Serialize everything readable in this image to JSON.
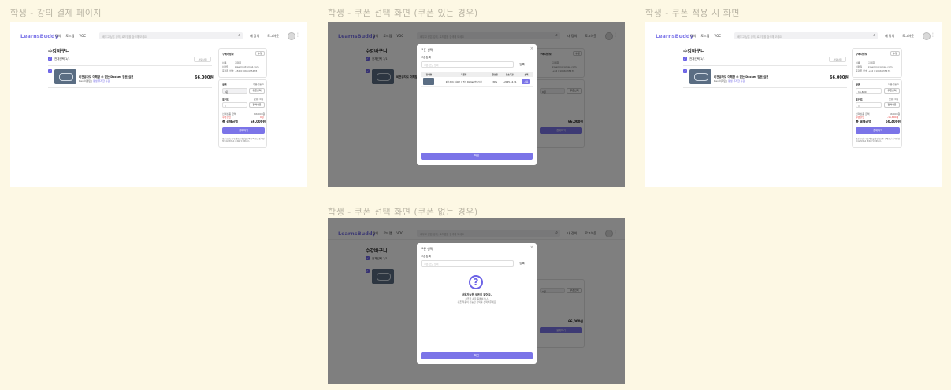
{
  "captions": [
    "학생 - 강의 결제 페이지",
    "학생 - 쿠폰 선택 화면 (쿠폰 있는 경우)",
    "학생 - 쿠폰 적용 시 화면",
    "학생 - 쿠폰 선택 화면 (쿠폰 없는 경우)"
  ],
  "header": {
    "logo": "LearnsBuddy",
    "nav": [
      "강의",
      "로드맵",
      "VOC"
    ],
    "search_placeholder": "배우고 싶은 강의, 로드맵을 검색해 보세요",
    "links": [
      "내 강의",
      "로그아웃"
    ]
  },
  "cart": {
    "title": "수강바구니",
    "select_all": "전체선택 1/1",
    "delete_selected": "선택삭제",
    "course": {
      "title": "비전공자도 이해할 수 있는 Docker 입문/실전",
      "author": "Dev 이재민",
      "tag": "평생 무제한 수강",
      "price": "66,000원"
    }
  },
  "buyer": {
    "title": "구매자정보",
    "edit": "수정",
    "name_label": "이름",
    "name": "김재희",
    "email_label": "이메일",
    "email": "kjaemin@gmail.com",
    "phone_label": "휴대폰 번호",
    "phone": "+82 01066435478"
  },
  "payment": {
    "coupon_label": "쿠폰",
    "coupon_count": "사용가능 1",
    "coupon_value_none": "0원",
    "coupon_value_applied": "15,600",
    "coupon_select": "쿠폰선택",
    "point_label": "포인트",
    "point_value": "보유: 0원",
    "point_input": "0",
    "point_all": "전액사용",
    "price_label": "선택상품 금액",
    "price": "66,000원",
    "discount_label": "쿠폰할인",
    "discount_none": "0원",
    "discount_applied": "-15,600원",
    "total_label": "총 결제금액",
    "total": "66,000원",
    "total_applied": "50,400원",
    "pay_button": "결제하기",
    "notice": "회원 본인은 주문내용을 확인했으며, 구매조건 및 개인정보처리방침과 결제에 동의합니다."
  },
  "modal": {
    "title": "쿠폰 선택",
    "code_label": "쿠폰등록",
    "code_placeholder": "쿠폰 코드 입력",
    "register": "등록",
    "columns": [
      "강의명",
      "쿠폰명",
      "할인율",
      "유효기간",
      "선택"
    ],
    "row": {
      "course": "비전공자도 이해할 수 있는 Docker 입문/실전",
      "coupon": "비전공자도 이해할 수 있는 Docker 입문/실전",
      "rate": "30%",
      "expiry": "~2025.12.31",
      "use": "사용"
    },
    "empty_title": "사용가능한 쿠폰이 없어요.",
    "empty_desc1": "쿠폰을 새로 등록하거나,",
    "empty_desc2": "쿠폰 적용이 가능한 강의를 선택해주세요",
    "confirm": "확인"
  }
}
